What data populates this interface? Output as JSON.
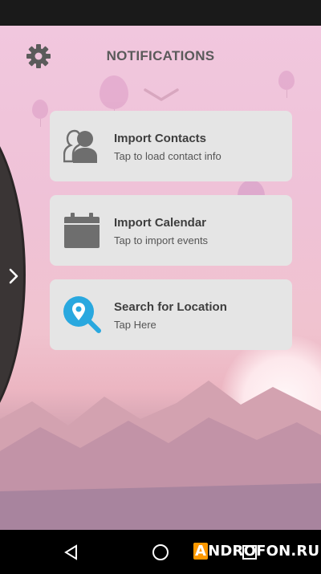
{
  "header": {
    "title": "NOTIFICATIONS"
  },
  "cards": [
    {
      "title": "Import Contacts",
      "subtitle": "Tap to load contact info",
      "icon": "contacts-icon"
    },
    {
      "title": "Import Calendar",
      "subtitle": "Tap to import events",
      "icon": "calendar-icon"
    },
    {
      "title": "Search for Location",
      "subtitle": "Tap Here",
      "icon": "location-search-icon"
    }
  ],
  "watermark": {
    "first_letter": "A",
    "rest": "NDROFON.RU"
  },
  "colors": {
    "accent_location": "#29a8df",
    "card_bg": "#e5e5e5",
    "icon_gray": "#6e6e6e"
  }
}
